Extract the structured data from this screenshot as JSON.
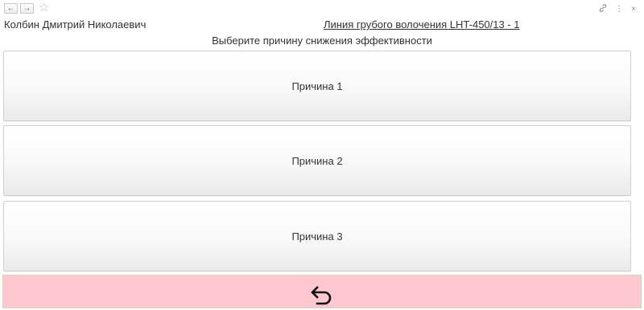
{
  "toolbar": {
    "back_icon": "arrow-left-icon",
    "forward_icon": "arrow-right-icon",
    "favorite_icon": "star-icon",
    "link_icon": "link-icon",
    "menu_icon": "vertical-dots-icon",
    "close_icon": "close-icon"
  },
  "header": {
    "user_name": "Колбин Дмитрий Николаевич",
    "line_link": "Линия грубого волочения LHT-450/13 - 1"
  },
  "prompt": "Выберите причину снижения эффективности",
  "reasons": [
    {
      "label": "Причина 1"
    },
    {
      "label": "Причина 2"
    },
    {
      "label": "Причина 3"
    }
  ],
  "back_button": {
    "icon": "undo-arrow-icon",
    "background_color": "#ffc8d1"
  }
}
